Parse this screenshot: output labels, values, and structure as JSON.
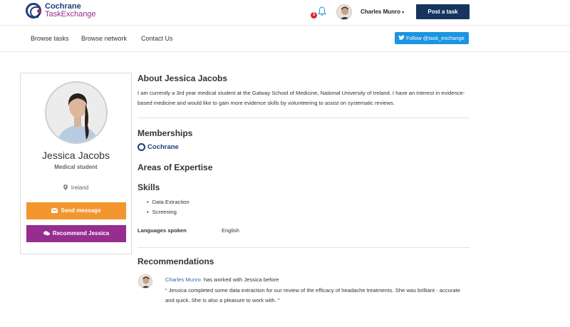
{
  "header": {
    "logo_line1": "Cochrane",
    "logo_line2": "TaskExchange",
    "notification_count": "3",
    "user_name": "Charles Munro",
    "post_task_label": "Post a task"
  },
  "nav": {
    "items": [
      {
        "label": "Browse tasks"
      },
      {
        "label": "Browse network"
      },
      {
        "label": "Contact Us"
      }
    ],
    "twitter_label": "Follow @task_exchange"
  },
  "profile": {
    "name": "Jessica Jacobs",
    "role": "Medical student",
    "location": "Ireland",
    "send_message_label": "Send message",
    "recommend_label": "Recommend Jessica"
  },
  "about": {
    "title": "About Jessica Jacobs",
    "text": "I am currently a 3rd year medical student at the Galway School of Medicine, National University of Ireland. I have an interest in evidence-based medicine and would like to gain more evidence skills by volunteering to assist on systematic reviews."
  },
  "memberships": {
    "title": "Memberships",
    "org": "Cochrane"
  },
  "expertise": {
    "title": "Areas of Expertise"
  },
  "skills": {
    "title": "Skills",
    "items": [
      "Data Extraction",
      "Screening"
    ]
  },
  "languages": {
    "label": "Languages spoken",
    "value": "English"
  },
  "recommendations": {
    "title": "Recommendations",
    "items": [
      {
        "author": "Charles Munro",
        "relation": "has worked with Jessica before",
        "quote": "“ Jessica completed some data extraction for our review of the efficacy of headache treatments. She was brilliant - accurate and quick. She is also a pleasure to work with. ”"
      }
    ]
  },
  "colors": {
    "brand_navy": "#17345f",
    "brand_purple": "#962d8f",
    "orange": "#f39630",
    "twitter": "#1b95e0",
    "badge_red": "#d9262c"
  }
}
